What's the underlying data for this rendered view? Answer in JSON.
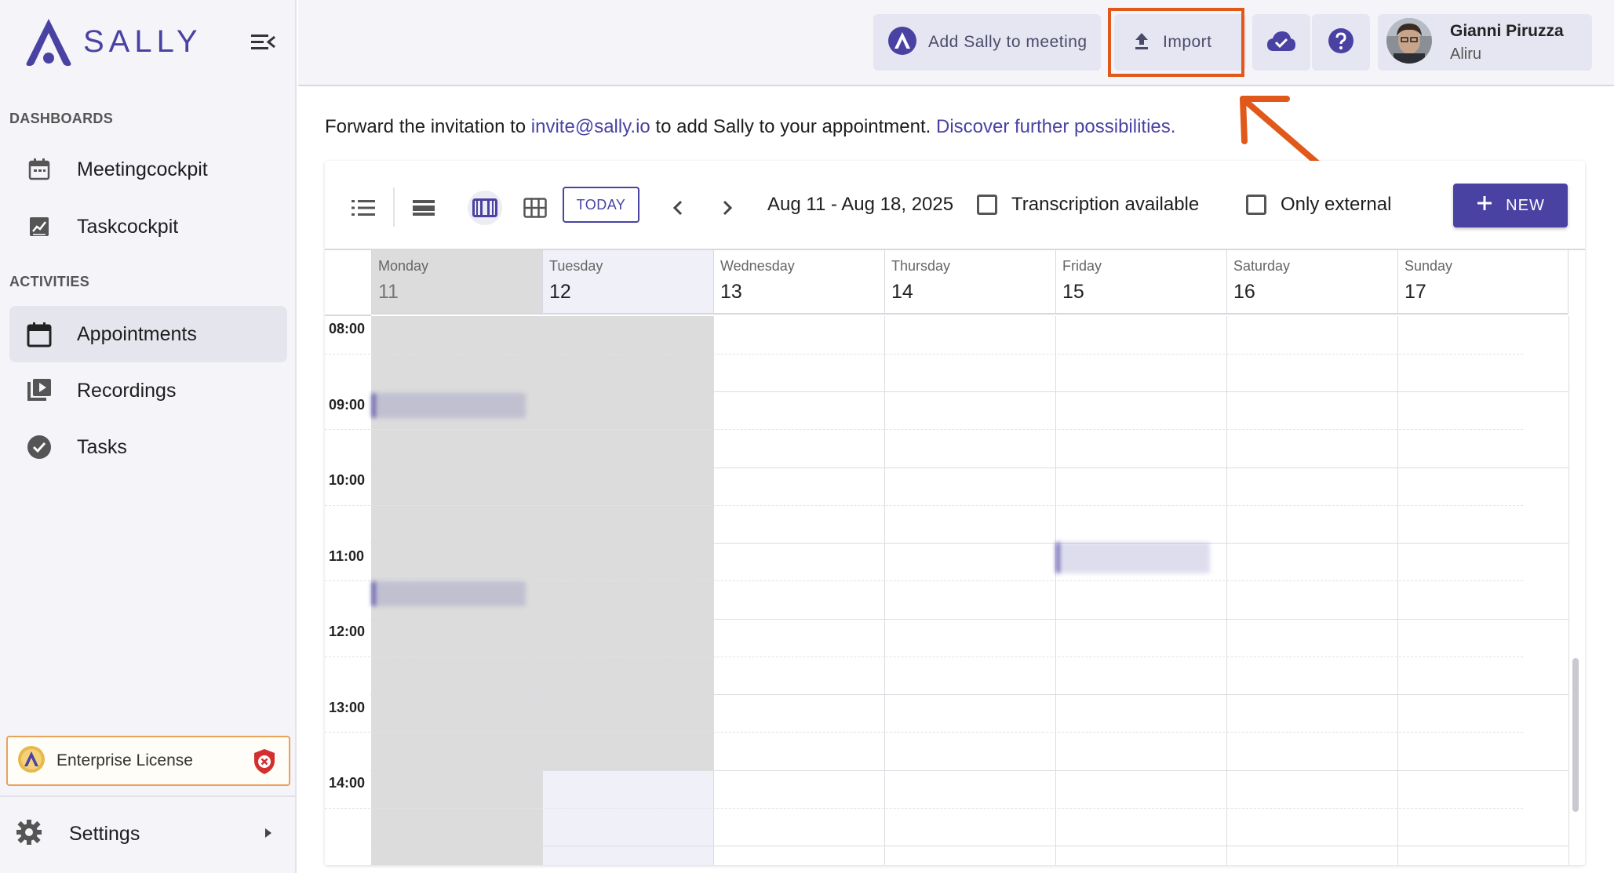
{
  "app": {
    "name": "SALLY",
    "brand_color": "#4a42a3",
    "annotation_color": "#e0591b"
  },
  "sidebar": {
    "sections": [
      {
        "title": "DASHBOARDS"
      },
      {
        "title": "ACTIVITIES"
      }
    ],
    "items": [
      {
        "label": "Meetingcockpit",
        "icon": "calendar-icon"
      },
      {
        "label": "Taskcockpit",
        "icon": "chart-icon"
      },
      {
        "label": "Appointments",
        "icon": "calendar-icon",
        "active": true
      },
      {
        "label": "Recordings",
        "icon": "video-library-icon"
      },
      {
        "label": "Tasks",
        "icon": "check-circle-icon"
      }
    ],
    "license": {
      "label": "Enterprise License"
    },
    "settings": {
      "label": "Settings"
    }
  },
  "header": {
    "add_sally_label": "Add Sally to meeting",
    "import_label": "Import",
    "user": {
      "name": "Gianni Piruzza",
      "org": "Aliru"
    }
  },
  "content": {
    "forward_prefix": "Forward the invitation to ",
    "forward_email": "invite@sally.io",
    "forward_middle": " to add Sally to your appointment. ",
    "forward_link": "Discover further possibilities."
  },
  "calendar": {
    "today_label": "TODAY",
    "range": "Aug 11 - Aug 18, 2025",
    "transcription_label": "Transcription available",
    "only_external_label": "Only external",
    "new_label": "NEW",
    "days": [
      {
        "name": "Monday",
        "num": "11"
      },
      {
        "name": "Tuesday",
        "num": "12"
      },
      {
        "name": "Wednesday",
        "num": "13"
      },
      {
        "name": "Thursday",
        "num": "14"
      },
      {
        "name": "Friday",
        "num": "15"
      },
      {
        "name": "Saturday",
        "num": "16"
      },
      {
        "name": "Sunday",
        "num": "17"
      }
    ],
    "times": [
      "08:00",
      "09:00",
      "10:00",
      "11:00",
      "12:00",
      "13:00",
      "14:00"
    ]
  }
}
